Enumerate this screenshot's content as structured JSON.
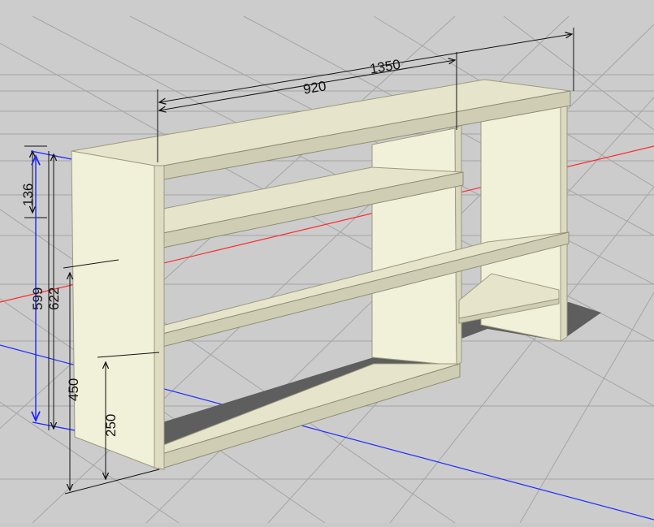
{
  "scene": {
    "title": "",
    "colors": {
      "background": "#cccccc",
      "grid_line": "#9e9e9e",
      "axis_x": "#ff2a2a",
      "axis_y": "#1f2cff",
      "panel": "#f1f0d8",
      "panel_edge": "#9c9a80",
      "shelf_top": "#e6e5cc",
      "shadow": "#5e5e5e",
      "dimension_line": "#111111",
      "selected_dimension": "#1c24ff"
    },
    "dimensions": {
      "overall_length": "1350",
      "section_length": "920",
      "total_height": "622",
      "inner_height": "599",
      "top_gap": "136",
      "middle_shelf_height": "450",
      "bottom_shelf_height": "250"
    }
  }
}
